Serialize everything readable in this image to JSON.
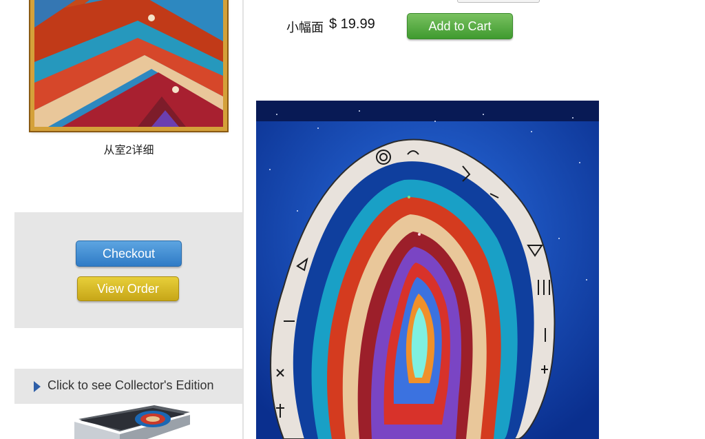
{
  "sidebar": {
    "thumbnail_caption": "从室2详细",
    "cart_panel": {
      "checkout_label": "Checkout",
      "view_order_label": "View Order"
    },
    "collector": {
      "label": "Click to see Collector's Edition",
      "arrow_icon": "triangle-right-icon"
    }
  },
  "product": {
    "size_label": "小幅面",
    "price": "$ 19.99",
    "add_to_cart_label": "Add to Cart"
  },
  "colors": {
    "checkout": "#3b87cf",
    "view_order": "#d4b527",
    "add_to_cart": "#52a83d",
    "panel_bg": "#e6e6e6",
    "frame_gold": "#d4a13a"
  }
}
